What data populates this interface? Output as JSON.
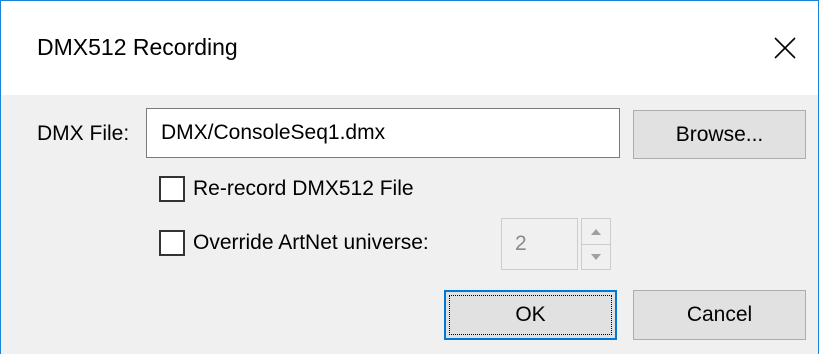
{
  "window": {
    "title": "DMX512 Recording",
    "close_icon": "close-x-icon"
  },
  "form": {
    "dmx_file_label": "DMX File:",
    "dmx_file_value": "DMX/ConsoleSeq1.dmx",
    "browse_label": "Browse...",
    "rerecord_label": "Re-record DMX512 File",
    "rerecord_checked": false,
    "override_label": "Override ArtNet universe:",
    "override_checked": false,
    "universe_value": "2",
    "universe_enabled": false
  },
  "buttons": {
    "ok_label": "OK",
    "cancel_label": "Cancel"
  },
  "colors": {
    "window_border": "#1883d7",
    "default_button_border": "#0078d7",
    "dialog_background": "#f0f0f0"
  }
}
